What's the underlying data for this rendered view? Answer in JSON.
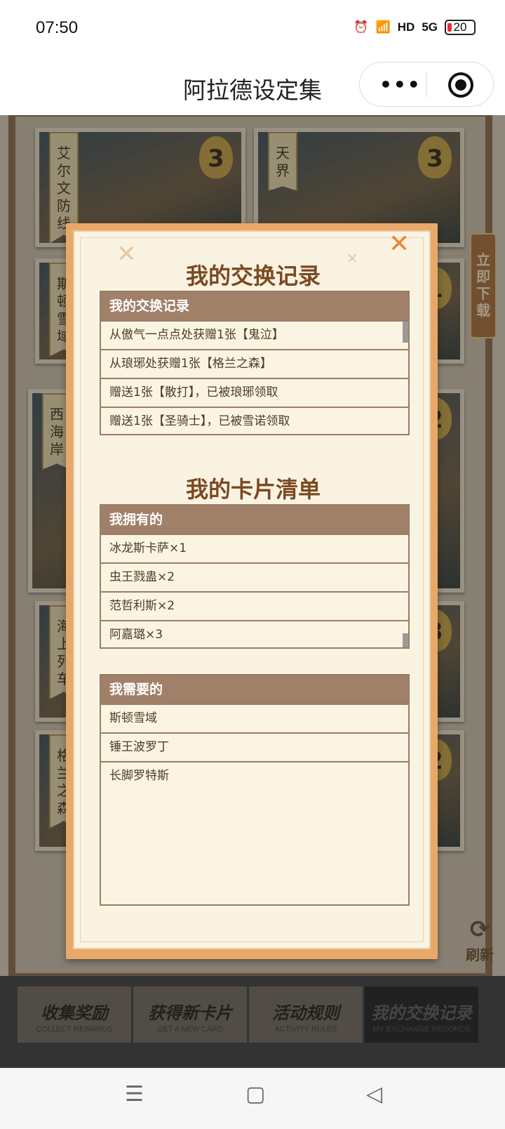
{
  "status_bar": {
    "time": "07:50",
    "network": "5G",
    "hd": "HD",
    "battery": "20"
  },
  "app": {
    "title": "阿拉德设定集",
    "more_icon": "•••"
  },
  "cards": [
    {
      "name": "艾尔文防线",
      "count": "3"
    },
    {
      "name": "天界",
      "count": "3"
    },
    {
      "name": "斯顿雪域",
      "count": "1"
    },
    {
      "name": "西海岸",
      "count": "2"
    },
    {
      "name": "海上列车",
      "count": "3"
    },
    {
      "name": "格兰之森",
      "count": "2"
    }
  ],
  "side_button": "立即下载",
  "refresh_label": "刷新",
  "tabs": [
    {
      "cn": "收集奖励",
      "en": "COLLECT REWARDS"
    },
    {
      "cn": "获得新卡片",
      "en": "GET A NEW CARD"
    },
    {
      "cn": "活动规则",
      "en": "ACTIVITY RULES"
    },
    {
      "cn": "我的交换记录",
      "en": "MY EXCHANGE RECORDS"
    }
  ],
  "modal": {
    "title": "我的交换记录",
    "records_header": "我的交换记录",
    "records": [
      "从傲气一点点处获赠1张【鬼泣】",
      "从琅琊处获赠1张【格兰之森】",
      "赠送1张【散打】，已被琅琊领取",
      "赠送1张【圣骑士】，已被雪诺领取"
    ],
    "cards_title": "我的卡片清单",
    "owned_header": "我拥有的",
    "owned": [
      "冰龙斯卡萨×1",
      "虫王戮蛊×2",
      "范哲利斯×2",
      "阿嘉璐×3"
    ],
    "needed_header": "我需要的",
    "needed": [
      "斯顿雪域",
      "锤王波罗丁",
      "长脚罗特斯"
    ]
  }
}
